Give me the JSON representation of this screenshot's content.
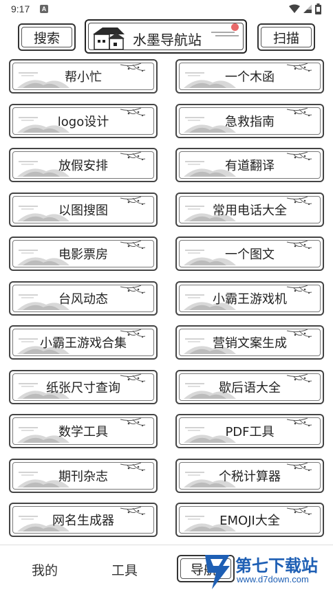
{
  "status_bar": {
    "time": "9:17",
    "notification_glyph": "A"
  },
  "header": {
    "search_label": "搜索",
    "title": "水墨导航站",
    "scan_label": "扫描"
  },
  "tools": [
    {
      "label": "帮小忙"
    },
    {
      "label": "一个木函"
    },
    {
      "label": "logo设计"
    },
    {
      "label": "急救指南"
    },
    {
      "label": "放假安排"
    },
    {
      "label": "有道翻译"
    },
    {
      "label": "以图搜图"
    },
    {
      "label": "常用电话大全"
    },
    {
      "label": "电影票房"
    },
    {
      "label": "一个图文"
    },
    {
      "label": "台风动态"
    },
    {
      "label": "小霸王游戏机"
    },
    {
      "label": "小霸王游戏合集"
    },
    {
      "label": "营销文案生成"
    },
    {
      "label": "纸张尺寸查询"
    },
    {
      "label": "歇后语大全"
    },
    {
      "label": "数学工具"
    },
    {
      "label": "PDF工具"
    },
    {
      "label": "期刊杂志"
    },
    {
      "label": "个税计算器"
    },
    {
      "label": "网名生成器"
    },
    {
      "label": "EMOJI大全"
    }
  ],
  "bottom_nav": {
    "items": [
      {
        "label": "我的"
      },
      {
        "label": "工具"
      },
      {
        "label": "导航"
      }
    ],
    "active_index": 2
  },
  "watermark": {
    "text": "第七下载站",
    "url": "www.d7down.com"
  },
  "colors": {
    "ink": "#222222",
    "sun": "#e86a6a",
    "watermark": "#1e5fb4"
  }
}
